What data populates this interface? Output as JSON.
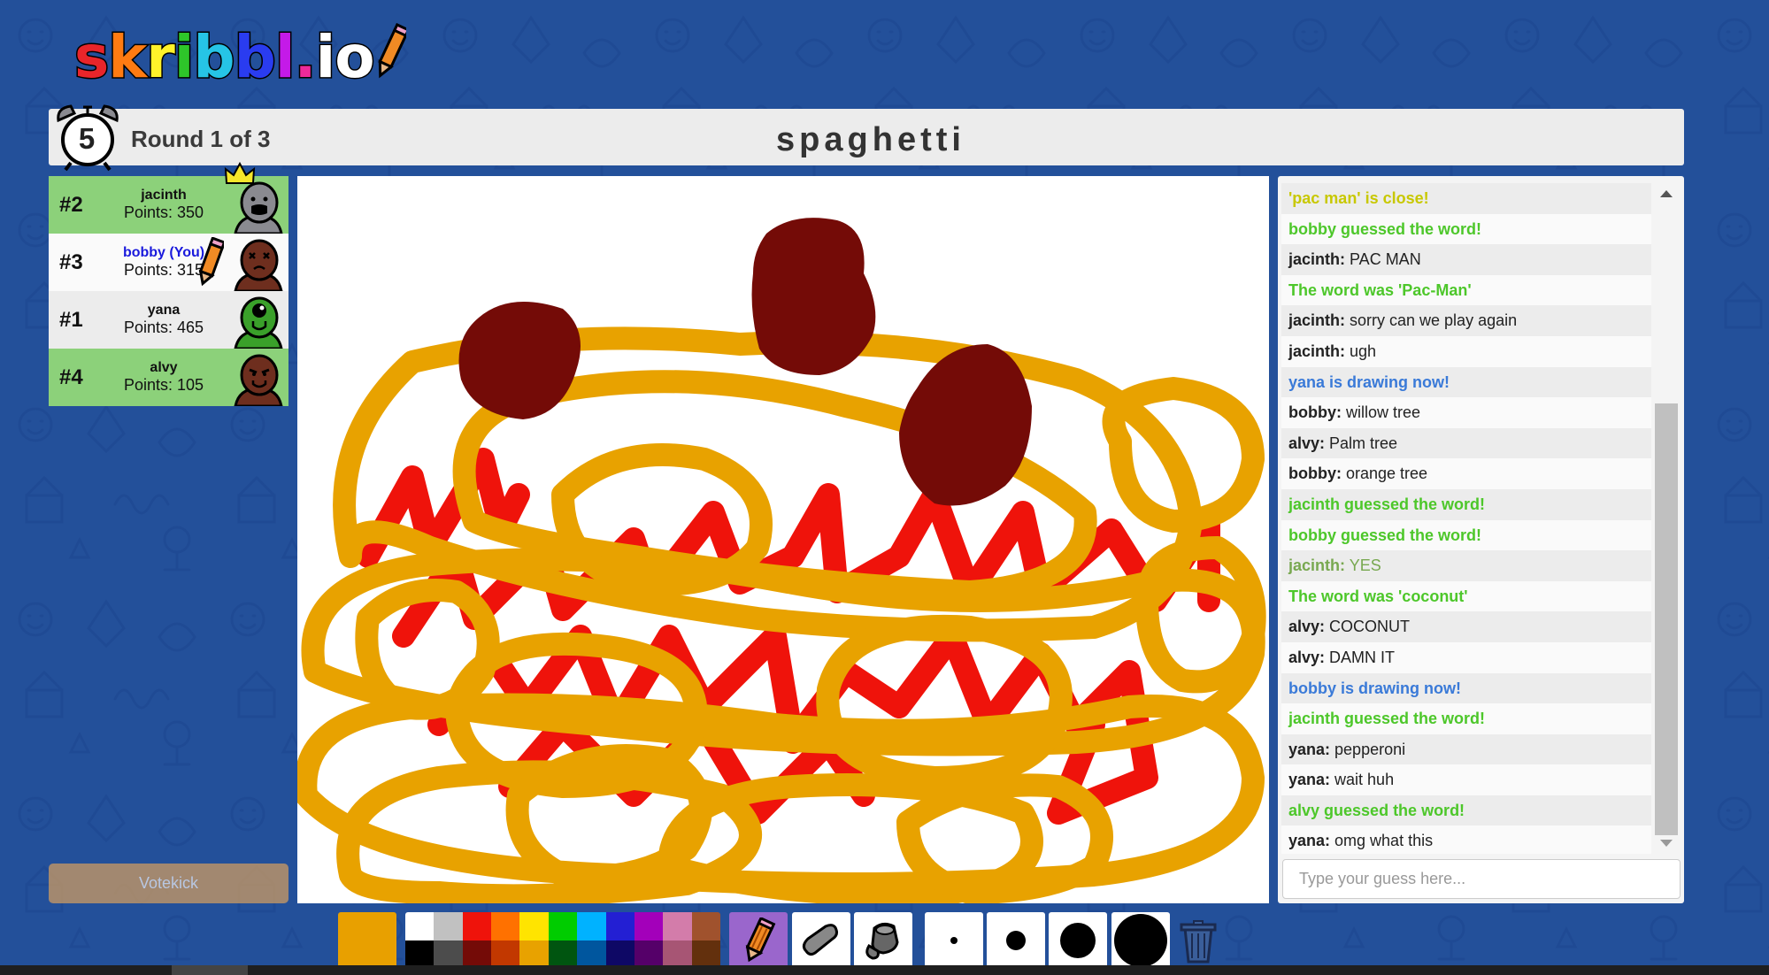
{
  "logo": {
    "letters": [
      {
        "ch": "s",
        "color": "#e8252a"
      },
      {
        "ch": "k",
        "color": "#ff7b12"
      },
      {
        "ch": "r",
        "color": "#fff22a"
      },
      {
        "ch": "i",
        "color": "#2ec62a"
      },
      {
        "ch": "b",
        "color": "#26c4e6"
      },
      {
        "ch": "b",
        "color": "#2a3cf0"
      },
      {
        "ch": "l",
        "color": "#c41ae8"
      },
      {
        "ch": ".",
        "color": "#ee2a9a"
      },
      {
        "ch": "i",
        "color": "#ffffff"
      },
      {
        "ch": "o",
        "color": "#ffffff"
      }
    ]
  },
  "header": {
    "timer": "5",
    "round": "Round 1 of 3",
    "word": "spaghetti"
  },
  "players": [
    {
      "rank": "#2",
      "name": "jacinth",
      "points": "Points: 350",
      "self": false,
      "bg": "green",
      "crown": true,
      "drawing": false,
      "avatar": {
        "skin": "#8a8a90",
        "face": "shout"
      }
    },
    {
      "rank": "#3",
      "name": "bobby (You)",
      "points": "Points: 315",
      "self": true,
      "bg": "white",
      "crown": false,
      "drawing": true,
      "avatar": {
        "skin": "#6e2e1e",
        "face": "dead"
      }
    },
    {
      "rank": "#1",
      "name": "yana",
      "points": "Points: 465",
      "self": false,
      "bg": "grey",
      "crown": false,
      "drawing": false,
      "avatar": {
        "skin": "#3aa02a",
        "face": "cyclops"
      }
    },
    {
      "rank": "#4",
      "name": "alvy",
      "points": "Points: 105",
      "self": false,
      "bg": "green",
      "crown": false,
      "drawing": false,
      "avatar": {
        "skin": "#6e2e1e",
        "face": "grin"
      }
    }
  ],
  "votekick": {
    "label": "Votekick"
  },
  "chat": {
    "messages": [
      {
        "type": "close",
        "text": "'pac man' is close!"
      },
      {
        "type": "guessed",
        "text": "bobby guessed the word!"
      },
      {
        "type": "chat",
        "author": "jacinth:",
        "text": " PAC MAN"
      },
      {
        "type": "guessed",
        "text": "The word was 'Pac-Man'"
      },
      {
        "type": "chat",
        "author": "jacinth:",
        "text": " sorry can we play again"
      },
      {
        "type": "chat",
        "author": "jacinth:",
        "text": " ugh"
      },
      {
        "type": "drawing",
        "text": "yana is drawing now!"
      },
      {
        "type": "chat",
        "author": "bobby:",
        "text": " willow tree"
      },
      {
        "type": "chat",
        "author": "alvy:",
        "text": " Palm tree"
      },
      {
        "type": "chat",
        "author": "bobby:",
        "text": " orange tree"
      },
      {
        "type": "guessed",
        "text": "jacinth guessed the word!"
      },
      {
        "type": "guessed",
        "text": "bobby guessed the word!"
      },
      {
        "type": "correct-chat",
        "author": "jacinth:",
        "text": " YES"
      },
      {
        "type": "guessed",
        "text": "The word was 'coconut'"
      },
      {
        "type": "chat",
        "author": "alvy:",
        "text": " COCONUT"
      },
      {
        "type": "chat",
        "author": "alvy:",
        "text": " DAMN IT"
      },
      {
        "type": "drawing",
        "text": "bobby is drawing now!"
      },
      {
        "type": "guessed",
        "text": "jacinth guessed the word!"
      },
      {
        "type": "chat",
        "author": "yana:",
        "text": " pepperoni"
      },
      {
        "type": "chat",
        "author": "yana:",
        "text": " wait huh"
      },
      {
        "type": "guessed",
        "text": "alvy guessed the word!"
      },
      {
        "type": "chat",
        "author": "yana:",
        "text": " omg what this"
      }
    ],
    "input_placeholder": "Type your guess here...",
    "input_value": ""
  },
  "toolbar": {
    "current_color": "#e8a000",
    "palette_top": [
      "#ffffff",
      "#c1c1c1",
      "#ef130b",
      "#ff7100",
      "#ffe400",
      "#00cc00",
      "#00b2ff",
      "#231fd3",
      "#a300ba",
      "#d37caa",
      "#a0522d"
    ],
    "palette_bottom": [
      "#000000",
      "#4c4c4c",
      "#740b07",
      "#c23800",
      "#e8a200",
      "#005510",
      "#00569e",
      "#0e0865",
      "#550069",
      "#a75574",
      "#63300d"
    ],
    "tools": [
      {
        "name": "pencil",
        "active": true
      },
      {
        "name": "eraser",
        "active": false
      },
      {
        "name": "fill",
        "active": false
      }
    ],
    "brush_sizes": [
      "small",
      "medium",
      "large",
      "xlarge"
    ]
  },
  "colors": {
    "background": "#23509a",
    "spaghetti": "#e8a200",
    "sauce": "#ef130b",
    "meatball": "#740b07"
  }
}
